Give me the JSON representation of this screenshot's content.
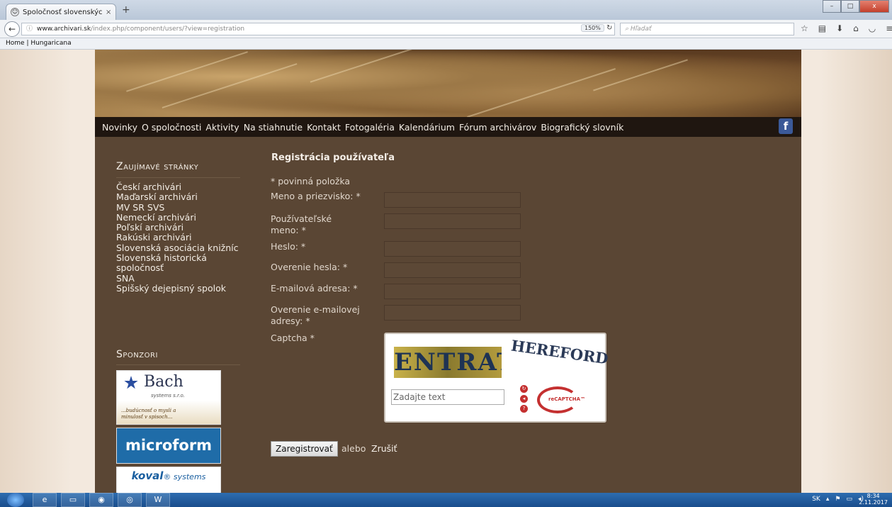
{
  "browser": {
    "tab_title": "Spoločnosť slovenských ar...",
    "tab_close": "×",
    "new_tab": "+",
    "url_domain": "www.archivari.sk",
    "url_path": "/index.php/component/users/?view=registration",
    "zoom": "150%",
    "search_placeholder": "Hľadať",
    "bookmark": "Home | Hungaricana"
  },
  "menu": [
    "Novinky",
    "O spoločnosti",
    "Aktivity",
    "Na stiahnutie",
    "Kontakt",
    "Fotogaléria",
    "Kalendárium",
    "Fórum archivárov",
    "Biografický slovník"
  ],
  "facebook_label": "f",
  "sidebar": {
    "heading_links": "Zaujímavé stránky",
    "links": [
      "Českí archivári",
      "Maďarskí archivári",
      "MV SR SVS",
      "Nemeckí archivári",
      "Poľskí archivári",
      "Rakúski archivári",
      "Slovenská asociácia knižníc",
      "Slovenská historická spoločnosť",
      "SNA",
      "Spišský dejepisný spolok"
    ],
    "heading_sponsors": "Sponzori",
    "sponsors": {
      "bach_name": "Bach",
      "bach_sub": "systems s.r.o.",
      "bach_tag": "...budúcnosť o mysli a minulosť v spisoch...",
      "microform": "microform",
      "koval": "koval",
      "koval_sub": "® systems"
    }
  },
  "form": {
    "title": "Registrácia používateľa",
    "required_note": "* povinná položka",
    "fields": [
      {
        "label": "Meno a priezvisko: *"
      },
      {
        "label": "Používateľské meno: *"
      },
      {
        "label": "Heslo: *"
      },
      {
        "label": "Overenie hesla: *"
      },
      {
        "label": "E-mailová adresa: *"
      },
      {
        "label": "Overenie e-mailovej adresy: *"
      }
    ],
    "captcha_label": "Captcha *",
    "captcha_word1": "ENTRATA",
    "captcha_word2": "HEREFORD",
    "captcha_placeholder": "Zadajte text",
    "captcha_brand": "reCAPTCHA™",
    "submit": "Zaregistrovať",
    "or": "alebo",
    "cancel": "Zrušiť"
  },
  "system": {
    "lang": "SK",
    "time": "8:34",
    "date": "2.11.2017"
  }
}
